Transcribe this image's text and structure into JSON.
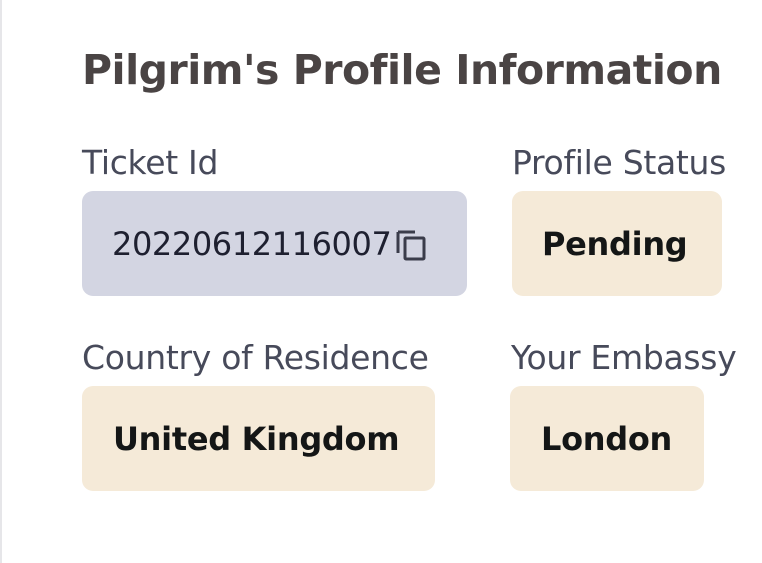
{
  "section": {
    "title": "Pilgrim's Profile Information"
  },
  "fields": {
    "ticket_id": {
      "label": "Ticket Id",
      "value": "20220612116007",
      "icon": "copy-icon"
    },
    "profile_status": {
      "label": "Profile Status",
      "value": "Pending"
    },
    "country_of_residence": {
      "label": "Country of Residence",
      "value": "United Kingdom"
    },
    "embassy": {
      "label": "Your Embassy",
      "value": "London"
    }
  },
  "colors": {
    "value_background_beige": "#f5ead8",
    "ticket_background_grey": "#d3d5e2",
    "title_text": "#4a4444",
    "label_text": "#474a5a"
  }
}
